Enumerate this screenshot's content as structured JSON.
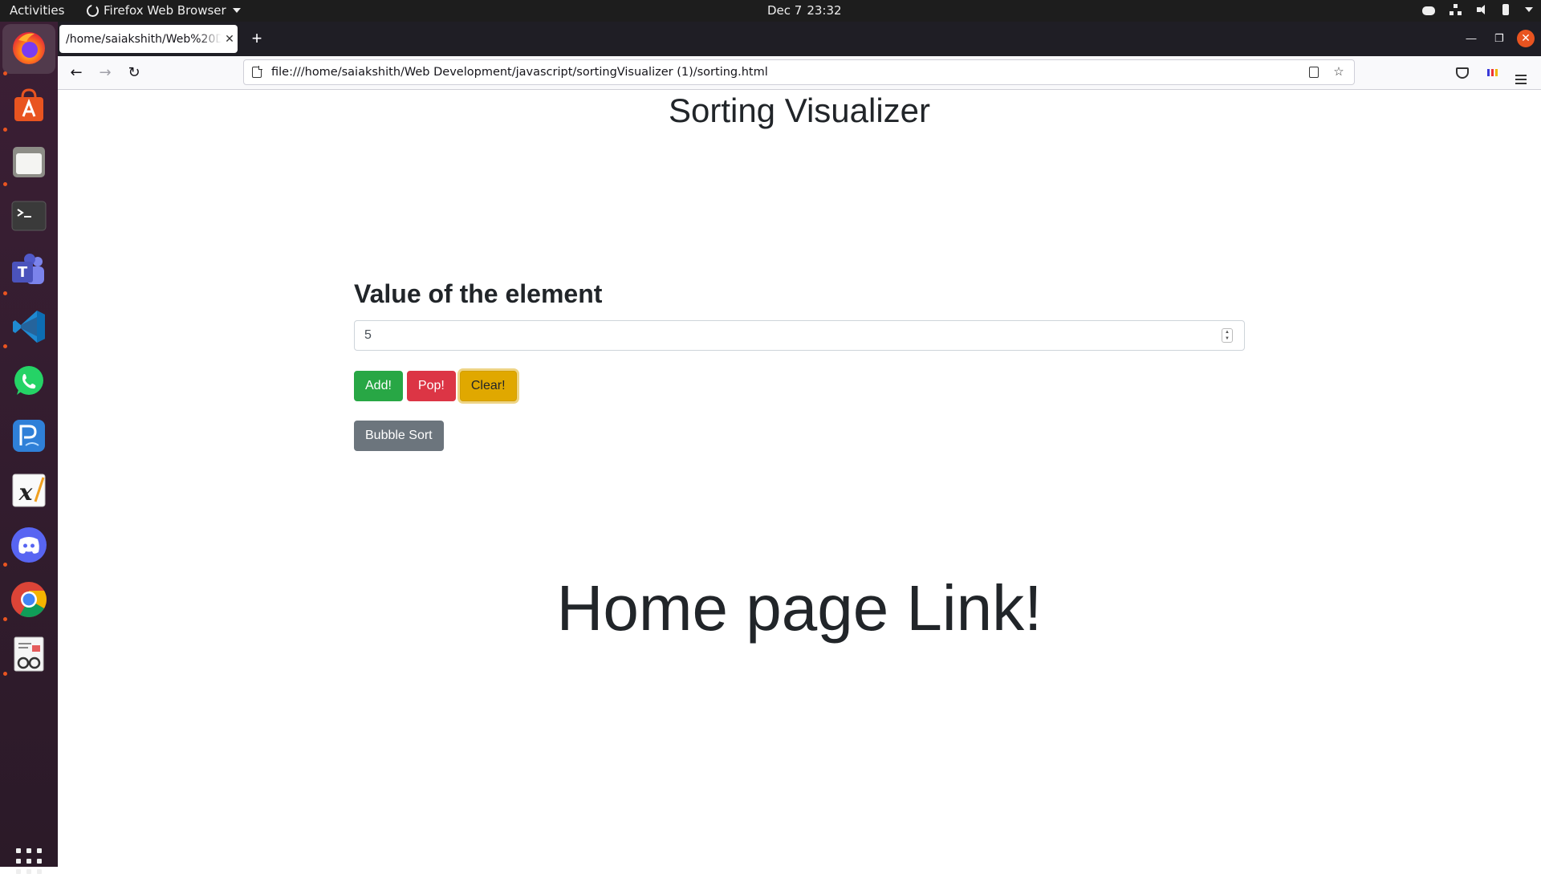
{
  "topbar": {
    "activities": "Activities",
    "app_name": "Firefox Web Browser",
    "date": "Dec 7",
    "time": "23:32"
  },
  "dock": {
    "items": [
      {
        "name": "firefox",
        "active": true
      },
      {
        "name": "ubuntu-software"
      },
      {
        "name": "files"
      },
      {
        "name": "terminal"
      },
      {
        "name": "teams"
      },
      {
        "name": "vscode"
      },
      {
        "name": "whatsapp"
      },
      {
        "name": "pdf-editor"
      },
      {
        "name": "xournal"
      },
      {
        "name": "discord"
      },
      {
        "name": "chrome"
      },
      {
        "name": "document-viewer"
      }
    ]
  },
  "browser": {
    "tab_title": "/home/saiakshith/Web%20D",
    "url": "file:///home/saiakshith/Web Development/javascript/sortingVisualizer (1)/sorting.html"
  },
  "page": {
    "title": "Sorting Visualizer",
    "form_label": "Value of the element",
    "input_value": "5",
    "buttons": {
      "add": "Add!",
      "pop": "Pop!",
      "clear": "Clear!",
      "bubble_sort": "Bubble Sort"
    },
    "home_link": "Home page Link!"
  },
  "colors": {
    "success": "#28a745",
    "danger": "#dc3545",
    "warning": "#e0a800",
    "secondary": "#6c757d",
    "ubuntu_orange": "#e95420"
  }
}
